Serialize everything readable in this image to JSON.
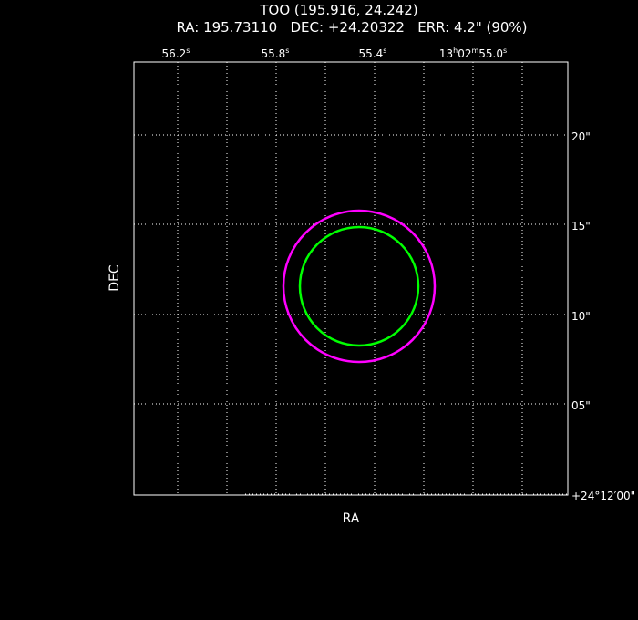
{
  "header": {
    "title": "TOO (195.916, 24.242)",
    "coords_line": "RA: 195.73110   DEC: +24.20322   ERR: 4.2\" (90%)"
  },
  "axes": {
    "x_label": "RA",
    "y_label": "DEC"
  },
  "ra_ticks": [
    {
      "main": "56.2",
      "sup": "s"
    },
    {
      "main": "55.8",
      "sup": "s"
    },
    {
      "main": "55.4",
      "sup": "s"
    },
    {
      "h": "13",
      "m": "02",
      "s": "55.0",
      "sup_h": "h",
      "sup_m": "m",
      "sup_s": "s"
    }
  ],
  "dec_ticks": [
    {
      "label": "20\""
    },
    {
      "label": "15\""
    },
    {
      "label": "10\""
    },
    {
      "label": "05\""
    },
    {
      "label": "+24°12′00\""
    }
  ],
  "circles": [
    {
      "name": "outer-error-circle",
      "color": "#ff00ff"
    },
    {
      "name": "inner-error-circle",
      "color": "#00ff00"
    }
  ]
}
